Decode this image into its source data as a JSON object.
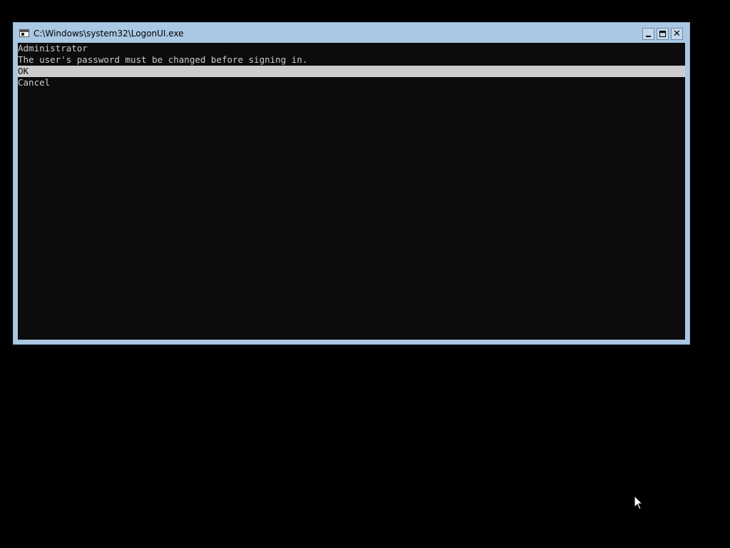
{
  "window": {
    "title": "C:\\Windows\\system32\\LogonUI.exe",
    "controls": {
      "minimize": "minimize-icon",
      "maximize": "maximize-icon",
      "close": "close-icon"
    }
  },
  "console": {
    "username": "Administrator",
    "message": "The user's password must be changed before signing in.",
    "options": [
      {
        "label": "OK",
        "selected": true
      },
      {
        "label": "Cancel",
        "selected": false
      }
    ]
  },
  "colors": {
    "frame": "#aac8e4",
    "console_bg": "#0c0c0c",
    "console_text": "#cccccc",
    "selection_bg": "#cccccc",
    "desktop": "#000000"
  }
}
